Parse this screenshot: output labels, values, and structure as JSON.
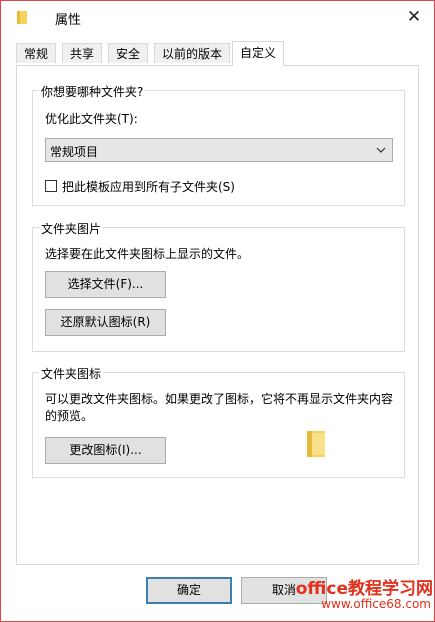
{
  "window": {
    "title": "属性",
    "close_glyph": "✕"
  },
  "tabs": [
    {
      "label": "常规"
    },
    {
      "label": "共享"
    },
    {
      "label": "安全"
    },
    {
      "label": "以前的版本"
    },
    {
      "label": "自定义",
      "active": true
    }
  ],
  "optimize_group": {
    "title": "你想要哪种文件夹?",
    "optimize_label": "优化此文件夹(T):",
    "select_value": "常规项目",
    "checkbox_label": "把此模板应用到所有子文件夹(S)",
    "checkbox_checked": false
  },
  "pictures_group": {
    "title": "文件夹图片",
    "description": "选择要在此文件夹图标上显示的文件。",
    "choose_file_button": "选择文件(F)...",
    "restore_default_button": "还原默认图标(R)"
  },
  "icons_group": {
    "title": "文件夹图标",
    "description_line1": "可以更改文件夹图标。如果更改了图标，它将不再显示文件夹内容",
    "description_line2": "的预览。",
    "change_icon_button": "更改图标(I)..."
  },
  "footer": {
    "ok_button": "确定",
    "cancel_button": "取消"
  },
  "watermark": {
    "text": "office教程学习网",
    "url": "www.office68.com"
  },
  "colors": {
    "folder": "#f7d35b",
    "accent": "#3c7fb1",
    "watermark": "#e0311d"
  }
}
